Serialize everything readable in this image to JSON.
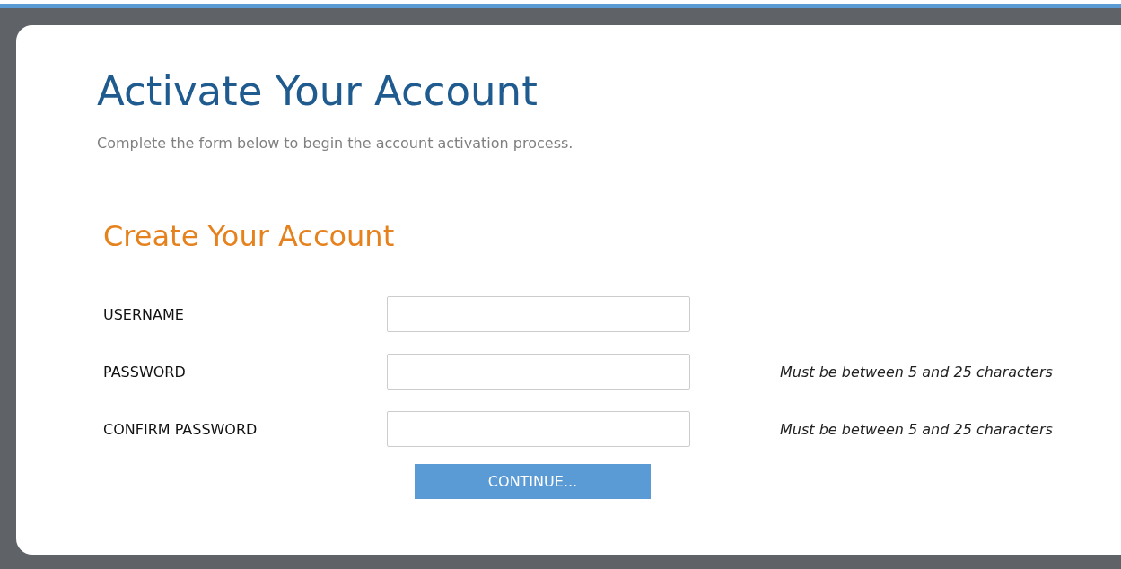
{
  "page": {
    "title": "Activate Your Account",
    "intro": "Complete the form below to begin the account activation process."
  },
  "form": {
    "heading": "Create Your Account",
    "fields": [
      {
        "label": "USERNAME"
      },
      {
        "label": "PASSWORD",
        "hint": "Must be between 5 and 25 characters"
      },
      {
        "label": "CONFIRM PASSWORD",
        "hint": "Must be between 5 and 25 characters"
      }
    ],
    "submit": "CONTINUE..."
  }
}
